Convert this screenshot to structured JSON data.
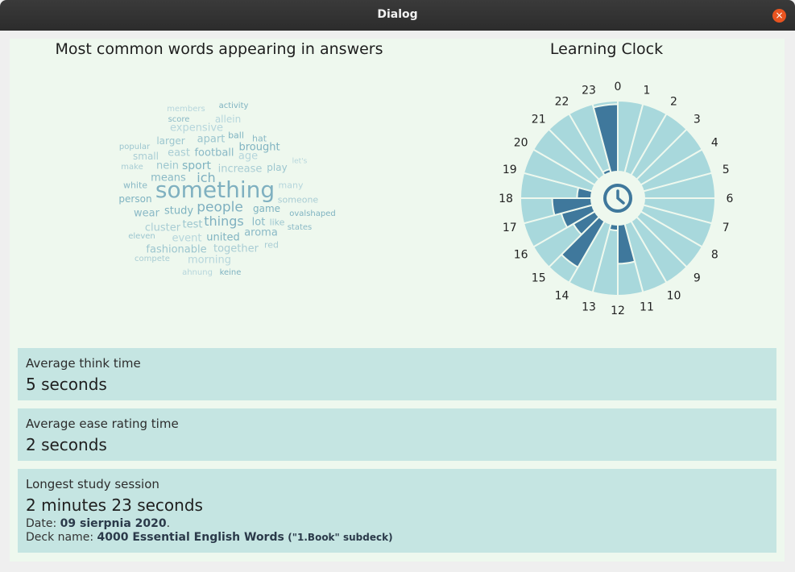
{
  "window": {
    "title": "Dialog",
    "close_glyph": "×"
  },
  "wordcloud": {
    "title": "Most common words appearing in answers",
    "words": [
      {
        "text": "something",
        "size": 28
      },
      {
        "text": "people",
        "size": 17
      },
      {
        "text": "things",
        "size": 16
      },
      {
        "text": "ich",
        "size": 16
      },
      {
        "text": "sport",
        "size": 14
      },
      {
        "text": "means",
        "size": 13
      },
      {
        "text": "nein",
        "size": 13
      },
      {
        "text": "increase",
        "size": 13
      },
      {
        "text": "expensive",
        "size": 13
      },
      {
        "text": "brought",
        "size": 13
      },
      {
        "text": "football",
        "size": 13
      },
      {
        "text": "apart",
        "size": 13
      },
      {
        "text": "east",
        "size": 13
      },
      {
        "text": "age",
        "size": 13
      },
      {
        "text": "study",
        "size": 13
      },
      {
        "text": "wear",
        "size": 13
      },
      {
        "text": "test",
        "size": 13
      },
      {
        "text": "cluster",
        "size": 13
      },
      {
        "text": "event",
        "size": 13
      },
      {
        "text": "united",
        "size": 13
      },
      {
        "text": "aroma",
        "size": 13
      },
      {
        "text": "fashionable",
        "size": 13
      },
      {
        "text": "together",
        "size": 13
      },
      {
        "text": "morning",
        "size": 13
      },
      {
        "text": "game",
        "size": 12
      },
      {
        "text": "lot",
        "size": 13
      },
      {
        "text": "larger",
        "size": 12
      },
      {
        "text": "small",
        "size": 12
      },
      {
        "text": "allein",
        "size": 12
      },
      {
        "text": "ball",
        "size": 11
      },
      {
        "text": "hat",
        "size": 11
      },
      {
        "text": "play",
        "size": 12
      },
      {
        "text": "someone",
        "size": 11
      },
      {
        "text": "many",
        "size": 11
      },
      {
        "text": "person",
        "size": 12
      },
      {
        "text": "white",
        "size": 11
      },
      {
        "text": "like",
        "size": 11
      },
      {
        "text": "red",
        "size": 11
      },
      {
        "text": "members",
        "size": 10
      },
      {
        "text": "activity",
        "size": 10
      },
      {
        "text": "score",
        "size": 10
      },
      {
        "text": "popular",
        "size": 10
      },
      {
        "text": "make",
        "size": 10
      },
      {
        "text": "let's",
        "size": 9
      },
      {
        "text": "ovalshaped",
        "size": 10
      },
      {
        "text": "states",
        "size": 10
      },
      {
        "text": "eleven",
        "size": 10
      },
      {
        "text": "compete",
        "size": 10
      },
      {
        "text": "ahnung",
        "size": 10
      },
      {
        "text": "keine",
        "size": 10
      }
    ]
  },
  "clock": {
    "title": "Learning Clock",
    "hours": [
      0,
      1,
      2,
      3,
      4,
      5,
      6,
      7,
      8,
      9,
      10,
      11,
      12,
      13,
      14,
      15,
      16,
      17,
      18,
      19,
      20,
      21,
      22,
      23
    ],
    "hour_labels": [
      "0",
      "1",
      "2",
      "3",
      "4",
      "5",
      "6",
      "7",
      "8",
      "9",
      "10",
      "11",
      "12",
      "13",
      "14",
      "15",
      "16",
      "17",
      "18",
      "19",
      "20",
      "21",
      "22",
      "23"
    ],
    "activity": [
      0,
      0,
      0,
      0,
      0,
      0,
      0,
      0,
      0,
      0,
      0,
      0,
      0,
      0,
      0.75,
      0.35,
      0.45,
      0.55,
      0.2,
      0,
      0,
      0,
      0.05,
      0.95
    ],
    "activity_hours": {
      "11": 0.55,
      "12": 0.08
    },
    "colors": {
      "sector": "#a8d8dc",
      "active": "#3f789c",
      "icon": "#3f789c",
      "label": "#222222"
    }
  },
  "stats": {
    "think_label": "Average think time",
    "think_value": "5 seconds",
    "ease_label": "Average ease rating time",
    "ease_value": "2 seconds",
    "long_label": "Longest study session",
    "long_value": "2 minutes 23 seconds",
    "date_prefix": "Date: ",
    "date_value": "09 sierpnia 2020",
    "date_suffix": ".",
    "deck_prefix": "Deck name: ",
    "deck_value": "4000 Essential English Words",
    "deck_sub": "(\"1.Book\" subdeck)"
  }
}
